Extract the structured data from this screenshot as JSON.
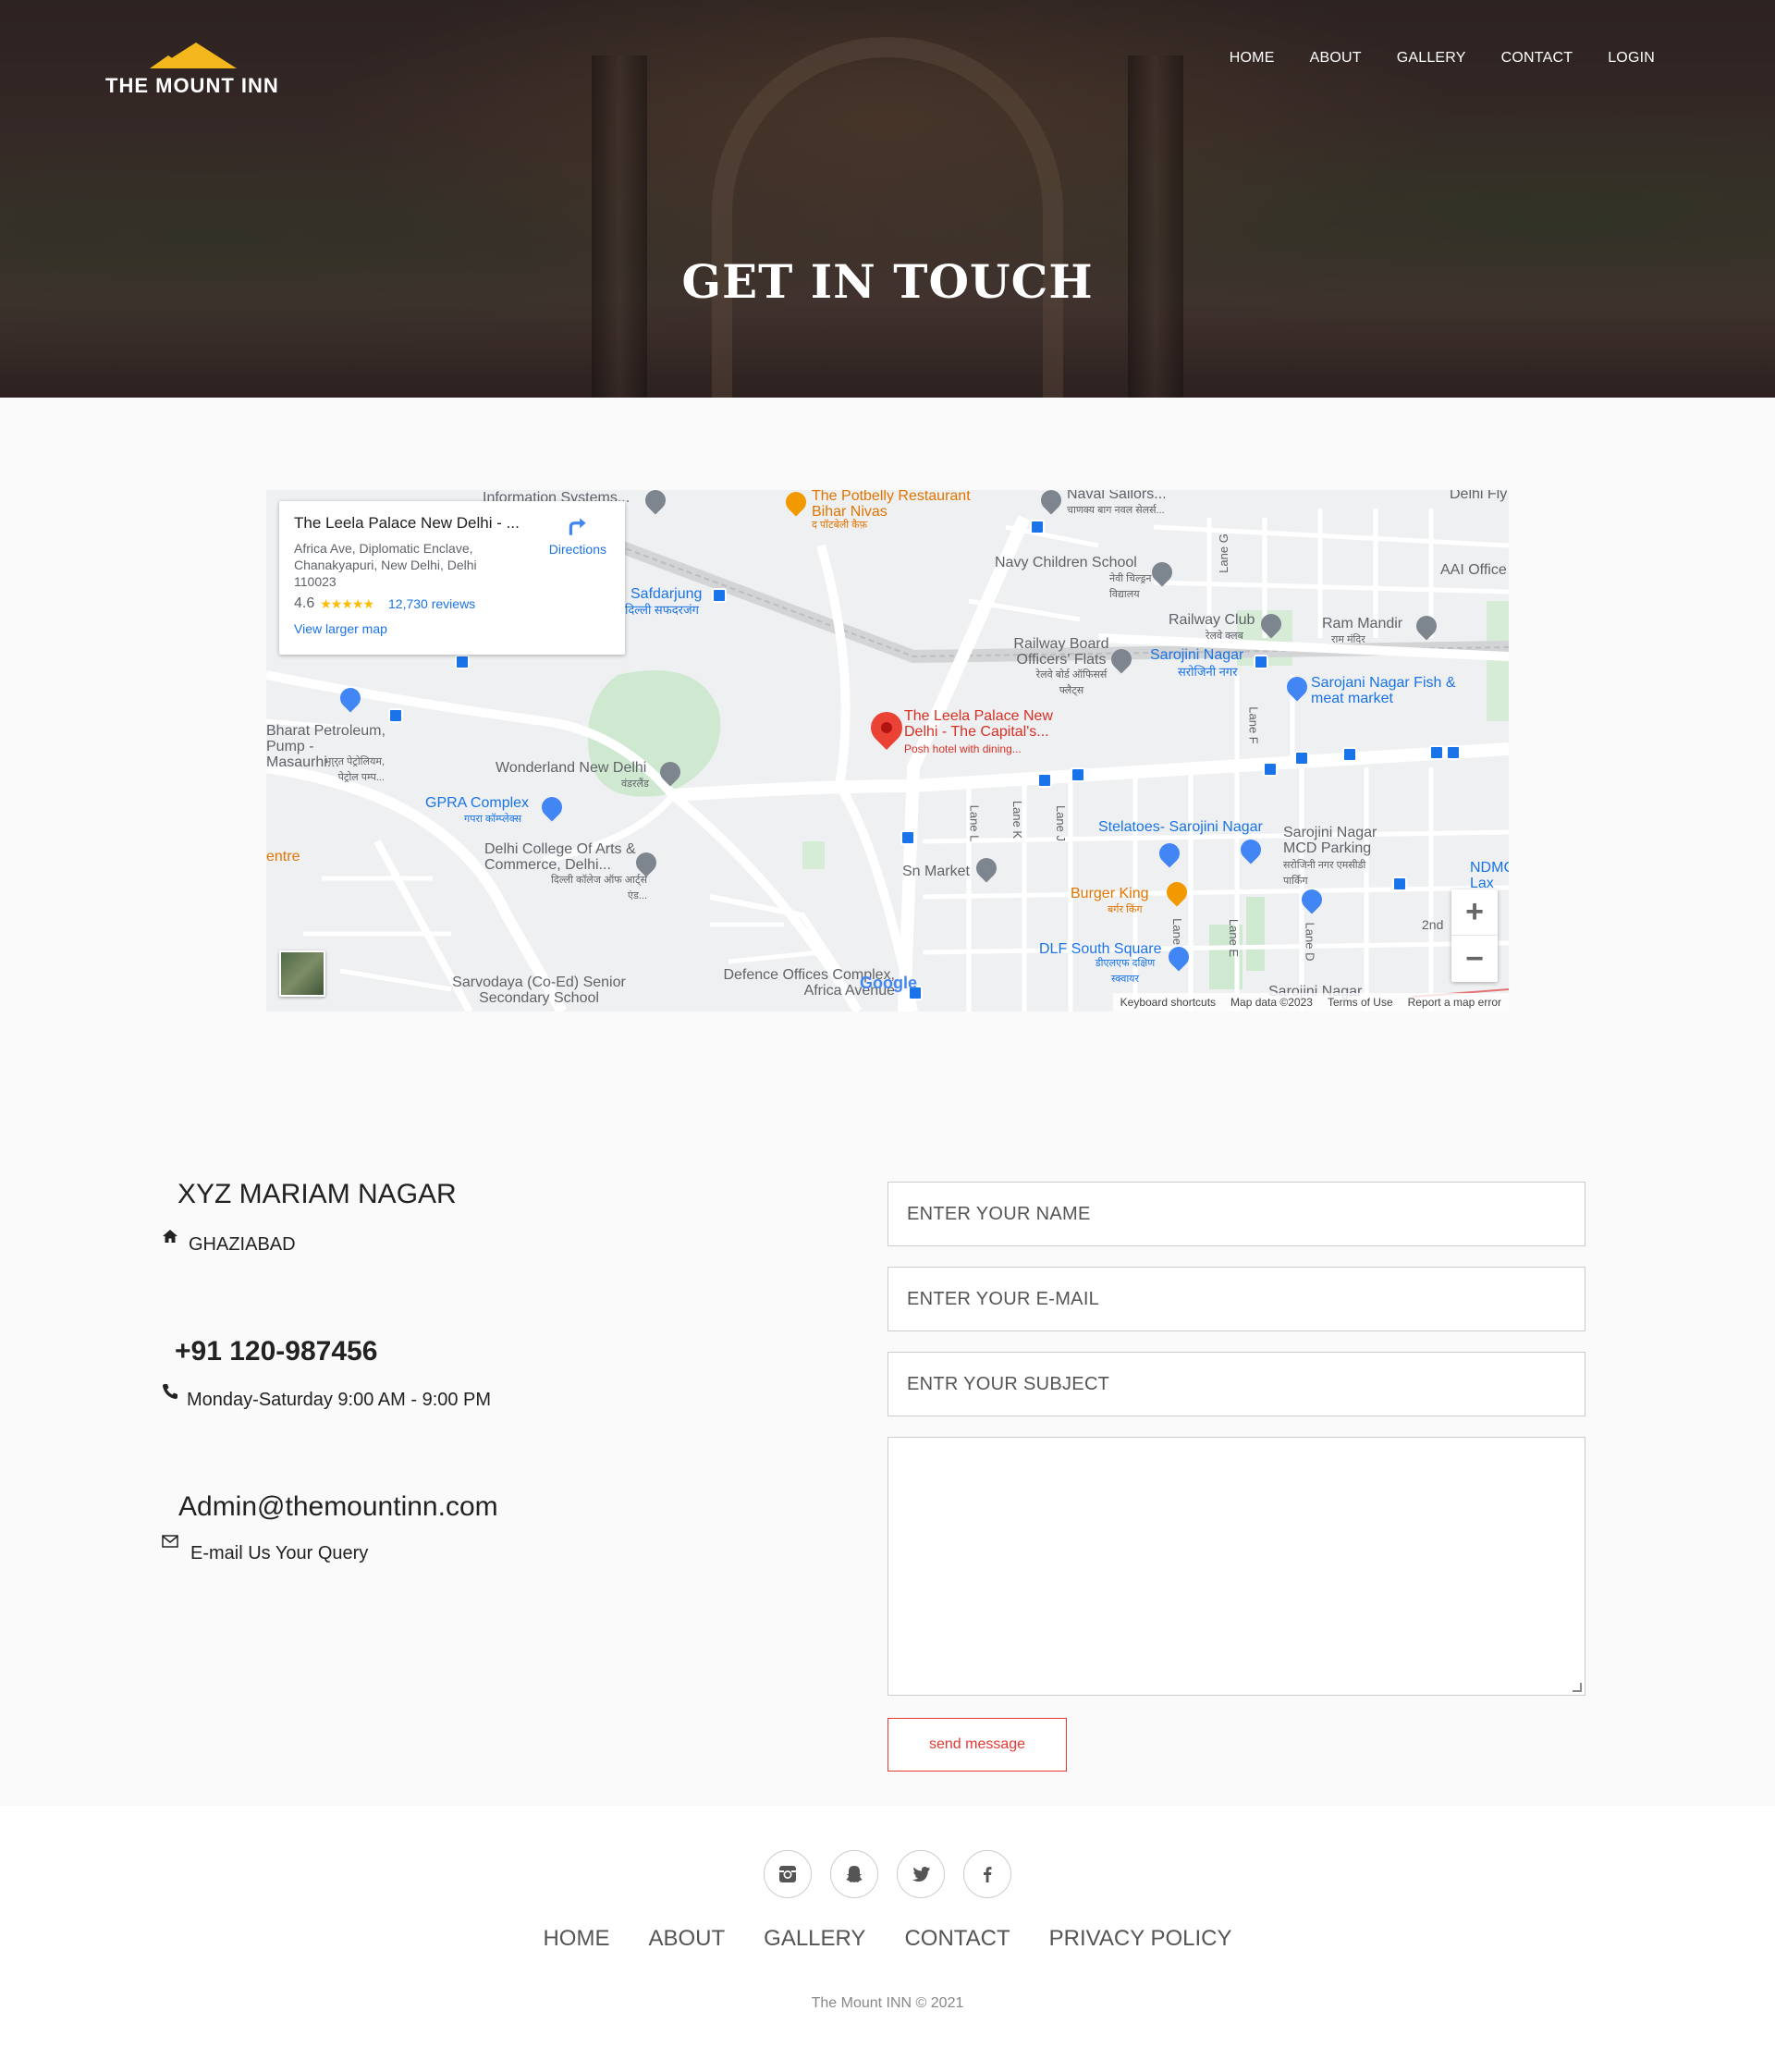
{
  "header": {
    "brand": "THE MOUNT INN",
    "nav": [
      "HOME",
      "ABOUT",
      "GALLERY",
      "CONTACT",
      "LOGIN"
    ],
    "title": "GET IN TOUCH"
  },
  "map": {
    "card": {
      "title": "The Leela Palace New Delhi - ...",
      "address": "Africa Ave, Diplomatic Enclave, Chanakyapuri, New Delhi, Delhi 110023",
      "rating": "4.6",
      "stars": "★★★★★",
      "reviews": "12,730 reviews",
      "larger_map": "View larger map",
      "directions": "Directions"
    },
    "places": {
      "info_systems": "Information Systems...",
      "potbelly": "The Potbelly Restaurant Bihar Nivas",
      "potbelly_hi": "द पॉटबेली कैफ़",
      "naval": "Naval Sailors...",
      "naval_hi": "चाणक्य बाग नवल सेलर्स...",
      "delhi_fly": "Delhi Fly",
      "lane_g_top": "Lane G",
      "safdarjung": "Safdarjung",
      "safdarjung_hi": "दिल्ली सफदरजंग",
      "navy_school": "Navy Children School",
      "navy_school_hi": "नेवी चिल्ड्रन विद्यालय",
      "aai": "AAI Office",
      "railway_club": "Railway Club",
      "railway_club_hi": "रेलवे क्लब",
      "ram_mandir": "Ram Mandir",
      "ram_mandir_hi": "राम मंदिर",
      "railway_board": "Railway Board Officers' Flats",
      "railway_board_hi": "रेलवे बोर्ड ऑफिसर्स फ्लैट्स",
      "sarojini_top": "Sarojini Nagar",
      "sarojini_top_hi": "सरोजिनी नगर",
      "sarojani_fish": "Sarojani Nagar Fish & meat market",
      "leela": "The Leela Palace New Delhi - The Capital's...",
      "leela_sub": "Posh hotel with dining...",
      "lane_f": "Lane F",
      "bharat": "Bharat Petroleum, Pump -Masaurhi...",
      "bharat_hi": "भारत पेट्रोलियम, पेट्रोल पम्प...",
      "wonderland": "Wonderland New Delhi",
      "wonderland_hi": "वंडरलैंड",
      "gpra": "GPRA Complex",
      "gpra_hi": "गपरा कॉम्प्लेक्स",
      "lane_l": "Lane L",
      "lane_k": "Lane K",
      "lane_j": "Lane J",
      "stelatoes": "Stelatoes- Sarojini Nagar",
      "mcd_parking": "Sarojini Nagar MCD Parking",
      "mcd_parking_hi": "सरोजिनी नगर एमसीडी पार्किंग",
      "ndmc": "NDMC Lax",
      "centre": "entre",
      "delhi_college": "Delhi College Of Arts & Commerce, Delhi...",
      "delhi_college_hi": "दिल्ली कॉलेज ऑफ आर्ट्स एंड...",
      "sn_market": "Sn Market",
      "burger_king": "Burger King",
      "burger_king_hi": "बर्गर किंग",
      "lane_g": "Lane G",
      "lane_e": "Lane E",
      "lane_d": "Lane D",
      "second": "2nd",
      "dlf": "DLF South Square",
      "dlf_hi": "डीएलएफ दक्षिण स्क्वायर",
      "sarvodaya": "Sarvodaya (Co-Ed) Senior Secondary School",
      "defence": "Defence Offices Complex, Africa Avenue",
      "sarojini_bottom": "Sarojini Nagar"
    },
    "footer": [
      "Keyboard shortcuts",
      "Map data ©2023",
      "Terms of Use",
      "Report a map error"
    ],
    "google": "Google",
    "zoom_in": "+",
    "zoom_out": "−"
  },
  "contact": {
    "address_title": "XYZ MARIAM NAGAR",
    "address_sub": "GHAZIABAD",
    "phone": "+91 120-987456",
    "hours": "Monday-Saturday 9:00 AM - 9:00 PM",
    "email": "Admin@themountinn.com",
    "email_sub": "E-mail Us Your Query"
  },
  "form": {
    "name_placeholder": "ENTER YOUR NAME",
    "email_placeholder": "ENTER YOUR E-MAIL",
    "subject_placeholder": "ENTR YOUR SUBJECT",
    "send_label": "send message"
  },
  "footer": {
    "nav": [
      "HOME",
      "ABOUT",
      "GALLERY",
      "CONTACT",
      "PRIVACY POLICY"
    ],
    "copyright": "The Mount INN © 2021",
    "social_icons": [
      "instagram-icon",
      "snapchat-icon",
      "twitter-icon",
      "facebook-icon"
    ]
  },
  "colors": {
    "accent": "#e53935",
    "logo": "#f5b81c",
    "map_link": "#1a73e8"
  }
}
